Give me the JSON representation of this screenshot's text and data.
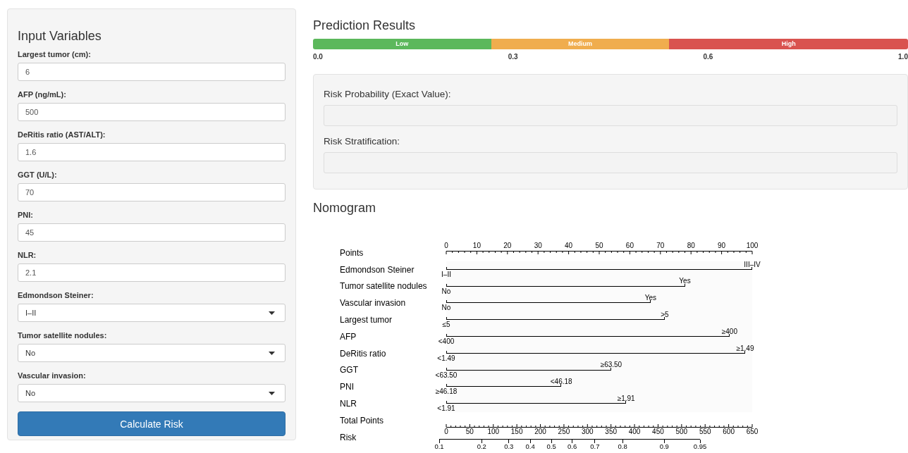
{
  "input_panel": {
    "title": "Input Variables",
    "fields": [
      {
        "kind": "number",
        "label": "Largest tumor (cm):",
        "value": "6"
      },
      {
        "kind": "number",
        "label": "AFP (ng/mL):",
        "value": "500"
      },
      {
        "kind": "number",
        "label": "DeRitis ratio (AST/ALT):",
        "value": "1.6"
      },
      {
        "kind": "number",
        "label": "GGT (U/L):",
        "value": "70"
      },
      {
        "kind": "number",
        "label": "PNI:",
        "value": "45"
      },
      {
        "kind": "number",
        "label": "NLR:",
        "value": "2.1"
      },
      {
        "kind": "select",
        "label": "Edmondson Steiner:",
        "value": "I–II"
      },
      {
        "kind": "select",
        "label": "Tumor satellite nodules:",
        "value": "No"
      },
      {
        "kind": "select",
        "label": "Vascular invasion:",
        "value": "No"
      }
    ],
    "button": "Calculate Risk"
  },
  "prediction": {
    "title": "Prediction Results",
    "scale": [
      {
        "label": "Low",
        "color": "#5cb85c"
      },
      {
        "label": "Medium",
        "color": "#f0ad4e"
      },
      {
        "label": "High",
        "color": "#d9534f"
      }
    ],
    "scale_ticks": [
      "0.0",
      "0.3",
      "0.6",
      "1.0"
    ],
    "outputs": [
      {
        "label": "Risk Probability (Exact Value):"
      },
      {
        "label": "Risk Stratification:"
      }
    ]
  },
  "nomogram": {
    "title": "Nomogram",
    "points_label": "Points",
    "points_ticks": [
      "0",
      "10",
      "20",
      "30",
      "40",
      "50",
      "60",
      "70",
      "80",
      "90",
      "100"
    ],
    "rows": [
      {
        "label": "Edmondson Steiner",
        "left": "I–II",
        "right": "III–IV",
        "level": 1.0
      },
      {
        "label": "Tumor satellite nodules",
        "left": "No",
        "right": "Yes",
        "level": 0.78
      },
      {
        "label": "Vascular invasion",
        "left": "No",
        "right": "Yes",
        "level": 0.668
      },
      {
        "label": "Largest tumor",
        "left": "≤5",
        "right": ">5",
        "level": 0.714
      },
      {
        "label": "AFP",
        "left": "<400",
        "right": "≥400",
        "level": 0.926
      },
      {
        "label": "DeRitis ratio",
        "left": "<1.49",
        "right": "≥1.49",
        "level": 0.977
      },
      {
        "label": "GGT",
        "left": "<63.50",
        "right": "≥63.50",
        "level": 0.539
      },
      {
        "label": "PNI",
        "left": "≥46.18",
        "right": "<46.18",
        "level": 0.376
      },
      {
        "label": "NLR",
        "left": "<1.91",
        "right": "≥1.91",
        "level": 0.588
      }
    ],
    "total_label": "Total Points",
    "total_ticks": [
      "0",
      "50",
      "100",
      "150",
      "200",
      "250",
      "300",
      "350",
      "400",
      "450",
      "500",
      "550",
      "600",
      "650"
    ],
    "risk_label": "Risk",
    "risk_ticks": [
      {
        "label": "0.1",
        "level": 0
      },
      {
        "label": "0.2",
        "level": 0.163
      },
      {
        "label": "0.3",
        "level": 0.267
      },
      {
        "label": "0.4",
        "level": 0.349
      },
      {
        "label": "0.5",
        "level": 0.43
      },
      {
        "label": "0.6",
        "level": 0.51
      },
      {
        "label": "0.7",
        "level": 0.597
      },
      {
        "label": "0.8",
        "level": 0.703
      },
      {
        "label": "0.9",
        "level": 0.863
      },
      {
        "label": "0.95",
        "level": 1.0
      }
    ]
  }
}
